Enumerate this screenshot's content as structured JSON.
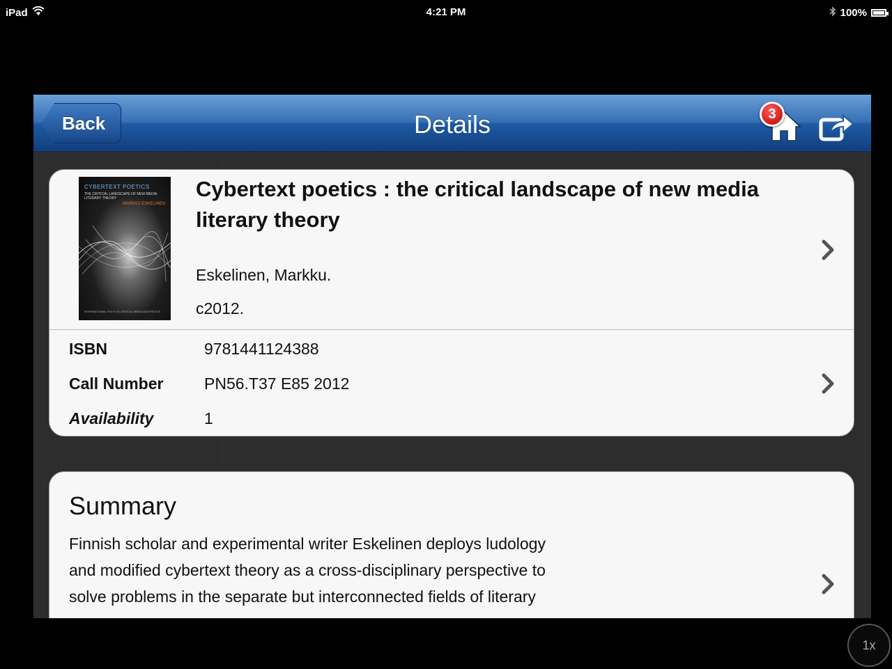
{
  "status_bar": {
    "device": "iPad",
    "time": "4:21 PM",
    "battery": "100%"
  },
  "navbar": {
    "back_label": "Back",
    "title": "Details",
    "badge_count": "3"
  },
  "book": {
    "cover": {
      "title": "CYBERTEXT POETICS",
      "subtitle": "THE CRITICAL LANDSCAPE OF NEW MEDIA LITERARY THEORY",
      "author": "MARKKU ESKELINEN",
      "footer": "INTERNATIONAL TEXTS IN CRITICAL MEDIA AESTHETICS"
    },
    "title": "Cybertext poetics : the critical landscape of new media literary theory",
    "author": "Eskelinen, Markku.",
    "date": "c2012."
  },
  "details": {
    "isbn_label": "ISBN",
    "isbn_value": "9781441124388",
    "call_label": "Call Number",
    "call_value": "PN56.T37 E85 2012",
    "availability_label": "Availability",
    "availability_value": "1"
  },
  "summary": {
    "heading": "Summary",
    "text": "Finnish scholar and experimental writer Eskelinen deploys ludology and modified cybertext theory as a cross-disciplinary perspective to solve problems in the separate but interconnected fields of literary"
  },
  "zoom": {
    "label": "1x"
  },
  "colors": {
    "navbar_top": "#6a9fd6",
    "navbar_bottom": "#123f7d",
    "badge": "#d40000",
    "card_bg": "#f7f7f7",
    "background": "#2d2d2d"
  },
  "icons": [
    "wifi-icon",
    "bluetooth-icon",
    "battery-icon",
    "home-icon",
    "share-icon",
    "chevron-right-icon"
  ]
}
